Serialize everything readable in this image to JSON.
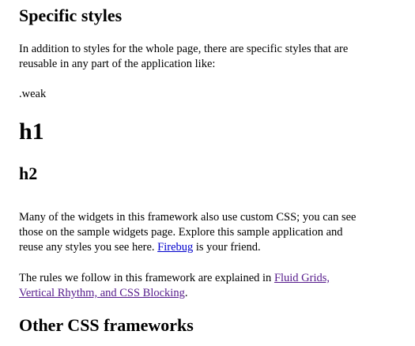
{
  "section1": {
    "title": "Specific styles",
    "intro": "In addition to styles for the whole page, there are specific styles that are reusable in any part of the application like:",
    "weak_label": ".weak",
    "demo_h1": "h1",
    "demo_h2": "h2"
  },
  "widgets_paragraph": {
    "text_before": "Many of the widgets in this framework also use custom CSS; you can see those on the sample widgets page. Explore this sample application and reuse any styles you see here. ",
    "firebug_link": "Firebug",
    "text_after": " is your friend."
  },
  "rules_paragraph": {
    "text_before": "The rules we follow in this framework are explained in ",
    "rules_link": "Fluid Grids, Vertical Rhythm, and CSS Blocking",
    "text_after": "."
  },
  "section2": {
    "title": "Other CSS frameworks"
  },
  "colors": {
    "link": "#0000cc",
    "visited_link": "#551a8b",
    "text": "#000000",
    "background": "#ffffff"
  }
}
